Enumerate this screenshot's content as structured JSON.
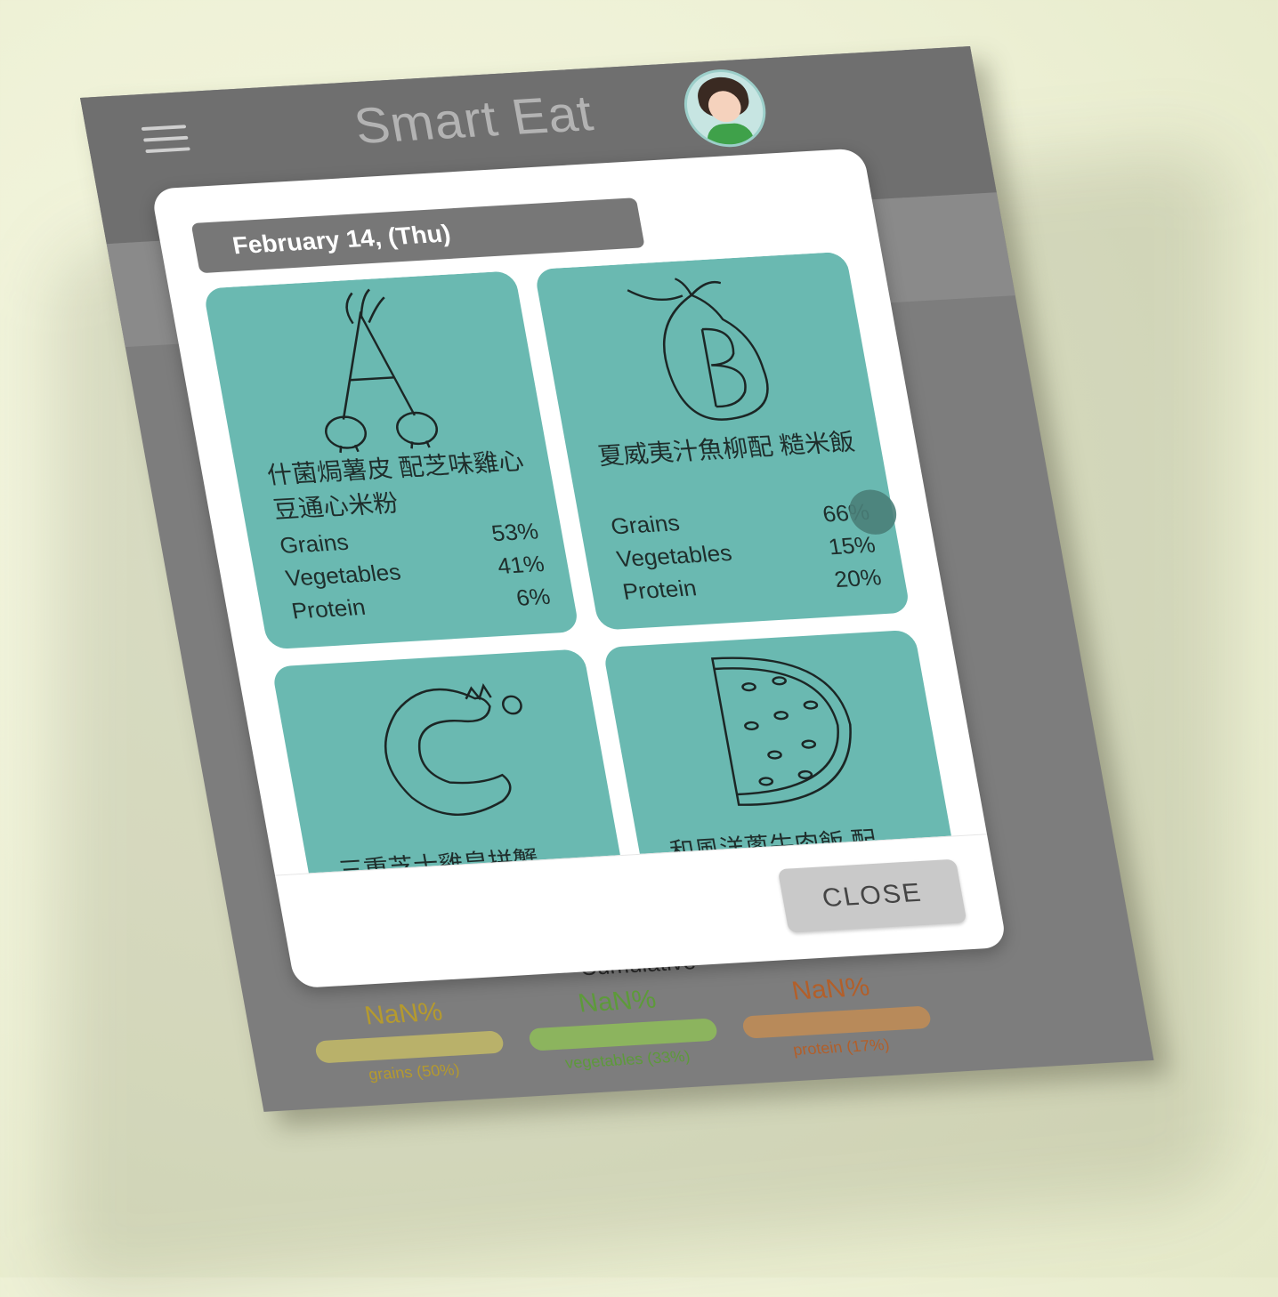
{
  "app": {
    "title": "Smart Eat"
  },
  "dialog": {
    "date": "February 14, (Thu)",
    "close_label": "CLOSE",
    "cards": [
      {
        "letter": "A",
        "name": "什菌焗薯皮 配芝味雞心豆通心米粉",
        "rows": [
          {
            "label": "Grains",
            "value": "53%"
          },
          {
            "label": "Vegetables",
            "value": "41%"
          },
          {
            "label": "Protein",
            "value": "6%"
          }
        ]
      },
      {
        "letter": "B",
        "name": "夏威夷汁魚柳配 糙米飯",
        "rows": [
          {
            "label": "Grains",
            "value": "66%"
          },
          {
            "label": "Vegetables",
            "value": "15%"
          },
          {
            "label": "Protein",
            "value": "20%"
          }
        ]
      },
      {
        "letter": "C",
        "name": "三重芝士雞皇拼蟹"
      },
      {
        "letter": "D",
        "name": "和風洋蔥牛肉飯 配"
      }
    ]
  },
  "cumulative": {
    "label": "Cumulative",
    "stats": [
      {
        "value": "NaN%",
        "caption": "grains (50%)"
      },
      {
        "value": "NaN%",
        "caption": "vegetables (33%)"
      },
      {
        "value": "NaN%",
        "caption": "protein (17%)"
      }
    ]
  },
  "colors": {
    "card": "#6ab9b1",
    "app_bar": "#6f6f6f",
    "grains": "#b59a2e",
    "vegetables": "#5d9a3a",
    "protein": "#b25f2a"
  }
}
